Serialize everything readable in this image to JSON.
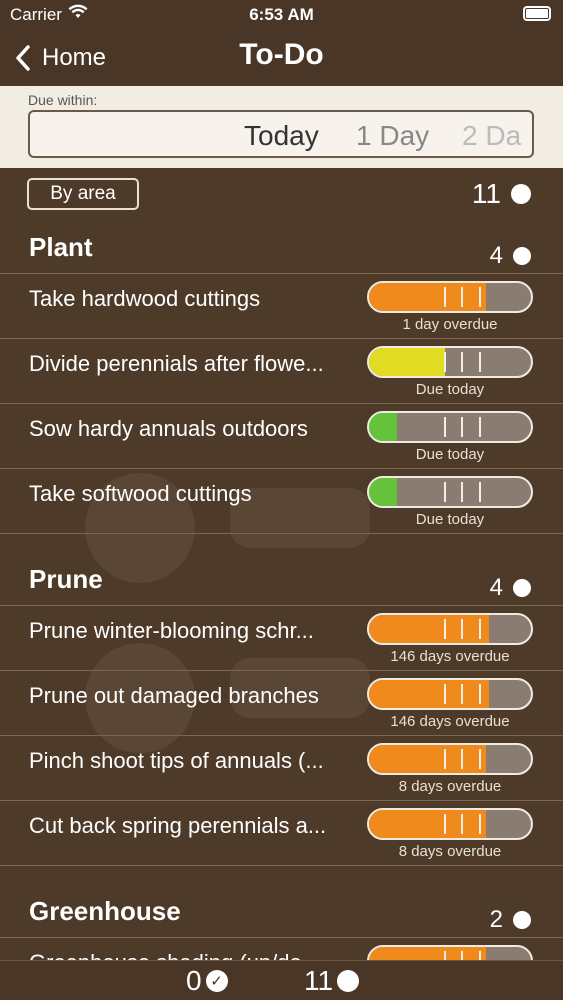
{
  "status_bar": {
    "carrier": "Carrier",
    "time": "6:53 AM"
  },
  "nav": {
    "back_label": "Home",
    "title": "To-Do"
  },
  "picker": {
    "caption": "Due within:",
    "options": [
      "Today",
      "1 Day",
      "2 Da"
    ]
  },
  "toolbar": {
    "by_area_label": "By area",
    "total_count": "11"
  },
  "sections": [
    {
      "title": "Plant",
      "count": "4",
      "tasks": [
        {
          "name": "Take hardwood cuttings",
          "status": "1 day overdue",
          "fill_color": "#f08a1c",
          "fill_fraction": 0.72
        },
        {
          "name": "Divide perennials after flowe...",
          "status": "Due today",
          "fill_color": "#e2dc22",
          "fill_fraction": 0.47
        },
        {
          "name": "Sow hardy annuals outdoors",
          "status": "Due today",
          "fill_color": "#66c23a",
          "fill_fraction": 0.17
        },
        {
          "name": "Take softwood cuttings",
          "status": "Due today",
          "fill_color": "#66c23a",
          "fill_fraction": 0.17
        }
      ]
    },
    {
      "title": "Prune",
      "count": "4",
      "tasks": [
        {
          "name": "Prune winter-blooming schr...",
          "status": "146 days overdue",
          "fill_color": "#f08a1c",
          "fill_fraction": 0.74
        },
        {
          "name": "Prune out damaged branches",
          "status": "146 days overdue",
          "fill_color": "#f08a1c",
          "fill_fraction": 0.74
        },
        {
          "name": "Pinch shoot tips of annuals (...",
          "status": "8 days overdue",
          "fill_color": "#f08a1c",
          "fill_fraction": 0.72
        },
        {
          "name": "Cut back spring perennials a...",
          "status": "8 days overdue",
          "fill_color": "#f08a1c",
          "fill_fraction": 0.72
        }
      ]
    },
    {
      "title": "Greenhouse",
      "count": "2",
      "tasks": [
        {
          "name": "Greenhouse shading (up/do...",
          "status": "",
          "fill_color": "#f08a1c",
          "fill_fraction": 0.72
        }
      ]
    }
  ],
  "bottom_bar": {
    "done_count": "0",
    "due_count": "11"
  },
  "colors": {
    "background": "#4e3a28",
    "bar_track": "#8a7c70",
    "overdue": "#f08a1c",
    "due_today_yellow": "#e2dc22",
    "due_today_green": "#66c23a"
  }
}
